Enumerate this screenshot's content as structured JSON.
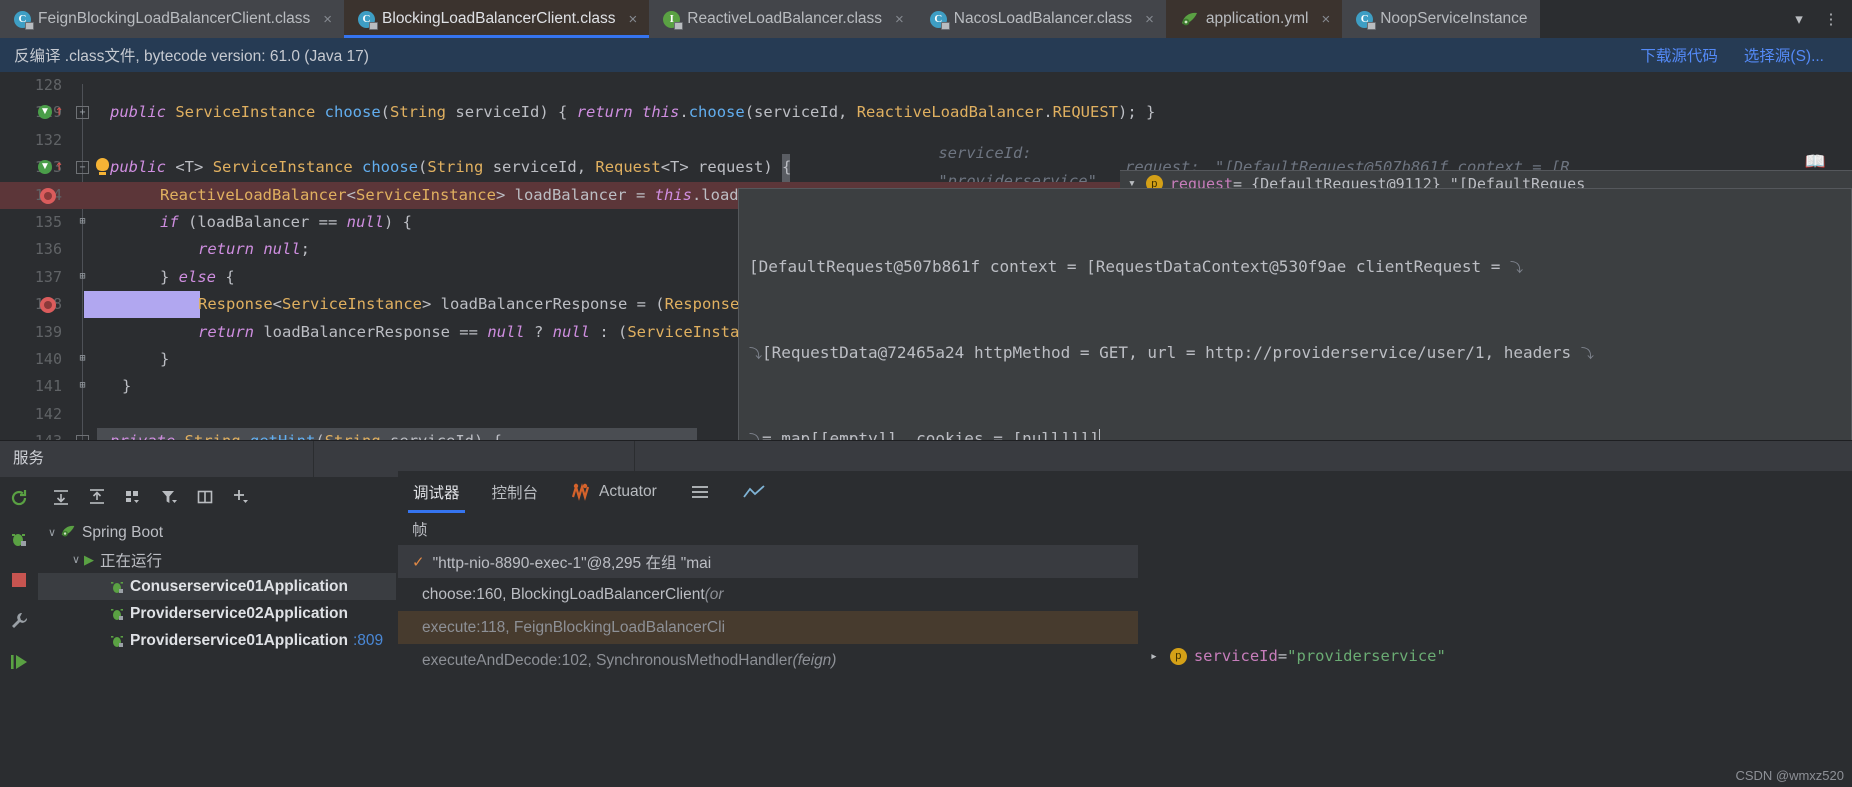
{
  "tabs": [
    {
      "label": "FeignBlockingLoadBalancerClient.class",
      "icon": "class-icon",
      "state": "inactive",
      "close": "×"
    },
    {
      "label": "BlockingLoadBalancerClient.class",
      "icon": "class-icon",
      "state": "active",
      "close": "×"
    },
    {
      "label": "ReactiveLoadBalancer.class",
      "icon": "interface-icon",
      "state": "inactive",
      "close": "×"
    },
    {
      "label": "NacosLoadBalancer.class",
      "icon": "class-icon",
      "state": "inactive",
      "close": "×"
    },
    {
      "label": "application.yml",
      "icon": "spring-yaml-icon",
      "state": "inactive",
      "close": "×"
    },
    {
      "label": "NoopServiceInstance",
      "icon": "class-icon",
      "state": "inactive",
      "close": ""
    }
  ],
  "tabbar": {
    "overflow_icon": "chevron-down-icon",
    "more_icon": "kebab-menu-icon",
    "class_letter": "C",
    "interface_letter": "I"
  },
  "notification": {
    "message": "反编译 .class文件, bytecode version: 61.0 (Java 17)",
    "link_download": "下载源代码",
    "link_choose": "选择源(S)..."
  },
  "editor": {
    "book_icon": "reader-mode-icon",
    "lines": [
      {
        "num": "128",
        "gutter": [],
        "text": ""
      },
      {
        "num": "129",
        "gutter": [
          "run-gradient-icon",
          "override-arrow-icon",
          "fold-plus"
        ],
        "text_html": "<span class=\"kw\">public</span> <span class=\"typ\">ServiceInstance</span> <span class=\"mth\">choose</span><span class=\"pln\">(</span><span class=\"typ\">String</span> <span class=\"pln\">serviceId) {</span> <span class=\"kw\">return</span> <span class=\"kw\">this</span><span class=\"pln\">.</span><span class=\"mth\">choose</span><span class=\"pln\">(serviceId, </span><span class=\"typ\">ReactiveLoadBalancer</span><span class=\"pln\">.</span><span class=\"typ\">REQUEST</span><span class=\"pln\">); }</span>"
      },
      {
        "num": "132",
        "gutter": [],
        "text": ""
      },
      {
        "num": "133",
        "gutter": [
          "run-gradient-icon",
          "override-arrow-icon",
          "fold-minus",
          "lightbulb-icon"
        ],
        "text_html": "<span class=\"kw\">public</span> <span class=\"pln\">&lt;T&gt;</span> <span class=\"typ\">ServiceInstance</span> <span class=\"mth\">choose</span><span class=\"pln\">(</span><span class=\"typ\">String</span> <span class=\"pln\">serviceId, </span><span class=\"typ\">Request</span><span class=\"pln\">&lt;T&gt; request)</span> <span class=\"cursorbar\">{</span>",
        "inlay1_key": "serviceId:",
        "inlay1_val": "\"providerservice\"",
        "inlay2_key": "request:",
        "inlay2_val": "\"[DefaultRequest@507b861f context = [R"
      },
      {
        "num": "134",
        "gutter": [
          "breakpoint-icon"
        ],
        "highlight": "red",
        "text_html": "<span class=\"typ\">ReactiveLoadBalancer</span><span class=\"pln\">&lt;</span><span class=\"typ\">ServiceInstance</span><span class=\"pln\">&gt; loadBalancer = </span><span class=\"kw\">this</span><span class=\"pln\">.</span><span class=\"pln\">loadBalancerClientFactory</span><span class=\"pln\">.</span><span class=\"mth\">getInstance</span><span class=\"pln\">(servic</span>"
      },
      {
        "num": "135",
        "gutter": [
          "fold-bracket"
        ],
        "text_html": "<span class=\"kw\">if</span> <span class=\"pln\">(loadBalancer == </span><span class=\"kw\">null</span><span class=\"pln\">) {</span>"
      },
      {
        "num": "136",
        "gutter": [],
        "text_html": "<span class=\"kw\">return</span> <span class=\"kw\">null</span><span class=\"pln\">;</span>"
      },
      {
        "num": "137",
        "gutter": [
          "fold-bracket"
        ],
        "text_html": "<span class=\"pln\">} </span><span class=\"kw\">else</span> <span class=\"pln\">{</span>"
      },
      {
        "num": "138",
        "gutter": [
          "breakpoint-icon"
        ],
        "highlight": "selection",
        "text_html": "<span class=\"typ\">Response</span><span class=\"pln\">&lt;</span><span class=\"typ\">ServiceInstance</span><span class=\"pln\">&gt; loadBalancerResponse = (</span><span class=\"typ\">Response</span>"
      },
      {
        "num": "139",
        "gutter": [],
        "text_html": "<span class=\"kw\">return</span> <span class=\"pln\">loadBalancerResponse == </span><span class=\"kw\">null</span> <span class=\"pln\">? </span><span class=\"kw\">null</span> <span class=\"pln\">: (</span><span class=\"typ\">ServiceInsta</span>"
      },
      {
        "num": "140",
        "gutter": [
          "fold-bracket"
        ],
        "text_html": "<span class=\"pln\">}</span>"
      },
      {
        "num": "141",
        "gutter": [
          "fold-bracket"
        ],
        "text_html": "<span class=\"pln\">}</span>"
      },
      {
        "num": "142",
        "gutter": [],
        "text": ""
      },
      {
        "num": "143",
        "gutter": [
          "fold-minus"
        ],
        "highlight": "line",
        "text_html": "<span class=\"kw\">private</span> <span class=\"typ\">String</span> <span class=\"mth\">getHint</span><span class=\"pln\">(</span><span class=\"typ\">String</span> <span class=\"pln\">serviceId) {</span>"
      }
    ]
  },
  "tooltip": {
    "chevron_icon": "chevron-down-icon",
    "param_badge": "p",
    "var_name": "request",
    "var_assign": " = {DefaultRequest@9112} \"[DefaultReques",
    "popup_text_line1": "[DefaultRequest@507b861f context = [RequestDataContext@530f9ae clientRequest = ",
    "popup_text_line2": "[RequestData@72465a24 httpMethod = GET, url = http://providerservice/user/1, headers ",
    "popup_text_line3": "= map[[empty]], cookies = [null]]]]",
    "wrap_glyph": "⤵"
  },
  "services": {
    "panel_title": "服务",
    "toolbar_icons": [
      "expand-all-icon",
      "collapse-all-icon",
      "group-by-icon",
      "filter-icon",
      "layout-icon",
      "add-icon"
    ],
    "rail_icons": [
      "rerun-icon",
      "debug-icon",
      "stop-icon",
      "settings-wrench-icon",
      "resume-icon"
    ],
    "tree": [
      {
        "label": "Spring Boot",
        "level": 0,
        "chevron": "∨",
        "icon": "spring-icon",
        "selected": false
      },
      {
        "label": "正在运行",
        "level": 1,
        "chevron": "∨",
        "icon": "run-triangle-icon",
        "selected": false
      },
      {
        "label": "Conuserservice01Application",
        "level": 2,
        "chevron": "",
        "icon": "bug-icon",
        "selected": true,
        "port": ""
      },
      {
        "label": "Providerservice02Application",
        "level": 2,
        "chevron": "",
        "icon": "bug-icon",
        "selected": false,
        "port": ""
      },
      {
        "label": "Providerservice01Application",
        "level": 2,
        "chevron": "",
        "icon": "bug-icon",
        "selected": false,
        "port": ":809"
      }
    ]
  },
  "debugger": {
    "tabs": [
      {
        "label": "调试器",
        "icon": "",
        "active": true
      },
      {
        "label": "控制台",
        "icon": "",
        "active": false
      },
      {
        "label": "Actuator",
        "icon": "actuator-icon",
        "active": false
      },
      {
        "label": "",
        "icon": "hamburger-icon",
        "active": false
      },
      {
        "label": "",
        "icon": "chart-icon",
        "active": false
      }
    ],
    "frames_header": "帧",
    "frames": [
      {
        "text": "\"http-nio-8890-exec-1\"@8,295 在组 \"mai",
        "check": true,
        "style": "sel"
      },
      {
        "text": "choose:160, BlockingLoadBalancerClient ",
        "italic": "(or",
        "style": "normal"
      },
      {
        "text": "execute:118, FeignBlockingLoadBalancerCli",
        "italic": "",
        "style": "hl"
      },
      {
        "text": "executeAndDecode:102, SynchronousMethodHandler ",
        "italic": "(feign)",
        "style": "dim"
      }
    ]
  },
  "bottom_tooltip": {
    "chevron_icon": "chevron-right-icon",
    "param_badge": "p",
    "name": "serviceId",
    "equals": " = ",
    "value": "\"providerservice\""
  },
  "watermark": "CSDN @wmxz520",
  "colors": {
    "accent_blue": "#3574f0",
    "link_blue": "#548af7",
    "notif_bg": "#263b54",
    "editor_bg": "#2b2d30",
    "panel_bg": "#393b40",
    "popup_bg": "#3c3f41",
    "bp_red": "#db5c5c",
    "error_line": "#5c3639",
    "selection": "#b1a7f0",
    "green": "#5aa143",
    "orange": "#e08845"
  }
}
